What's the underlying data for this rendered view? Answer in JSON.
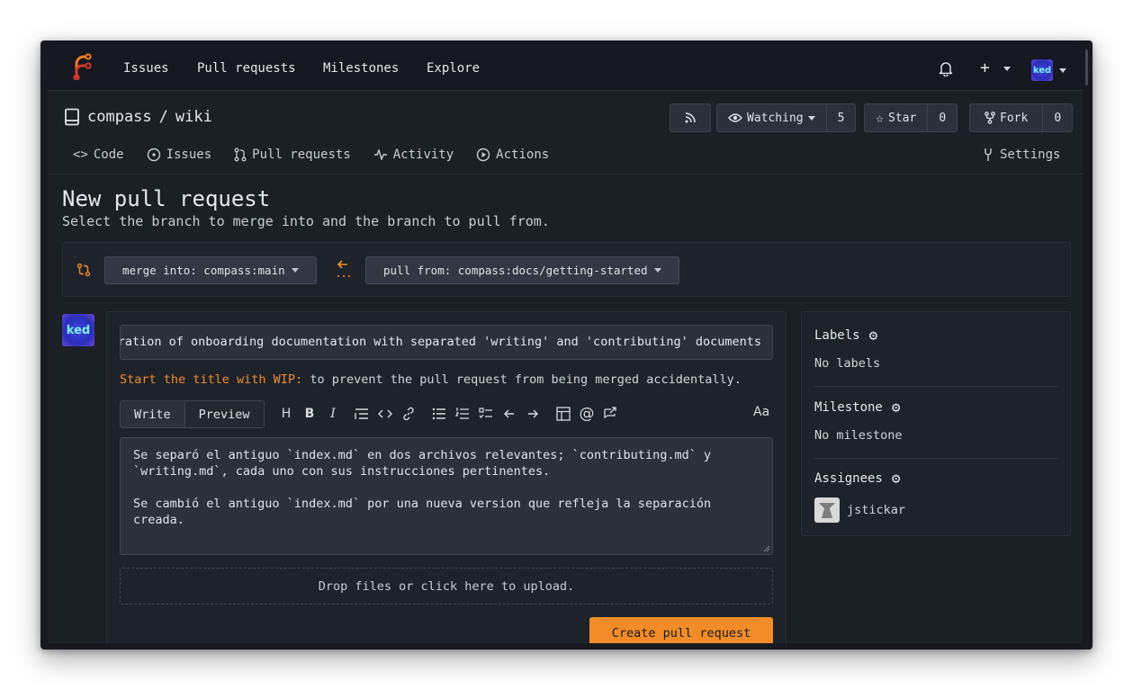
{
  "nav": {
    "links": [
      "Issues",
      "Pull requests",
      "Milestones",
      "Explore"
    ],
    "avatar_text": "ked"
  },
  "repo": {
    "owner": "compass",
    "separator": "/",
    "name": "wiki",
    "watch_label": "Watching",
    "watch_count": "5",
    "star_label": "Star",
    "star_count": "0",
    "fork_label": "Fork",
    "fork_count": "0"
  },
  "tabs": {
    "code": "Code",
    "issues": "Issues",
    "pull_requests": "Pull requests",
    "activity": "Activity",
    "actions": "Actions",
    "settings": "Settings"
  },
  "page": {
    "title": "New pull request",
    "subtitle": "Select the branch to merge into and the branch to pull from."
  },
  "branches": {
    "merge_into": "merge into: compass:main",
    "pull_from": "pull from: compass:docs/getting-started"
  },
  "form": {
    "title_value": "Separation of onboarding documentation with separated 'writing' and 'contributing' documents",
    "wip_prefix": "Start the title with WIP:",
    "wip_suffix": " to prevent the pull request from being merged accidentally.",
    "write_tab": "Write",
    "preview_tab": "Preview",
    "font_toggle": "Aa",
    "body_value": "Se separó el antiguo `index.md` en dos archivos relevantes; `contributing.md` y\n`writing.md`, cada uno con sus instrucciones pertinentes.\n\nSe cambió el antiguo `index.md` por una nueva version que refleja la separación\ncreada.",
    "dropzone": "Drop files or click here to upload.",
    "submit": "Create pull request"
  },
  "sidebar": {
    "labels_head": "Labels",
    "labels_value": "No labels",
    "milestone_head": "Milestone",
    "milestone_value": "No milestone",
    "assignees_head": "Assignees",
    "assignee_name": "jstickar"
  },
  "colors": {
    "accent": "#f28c28",
    "background": "#1b1f26"
  }
}
